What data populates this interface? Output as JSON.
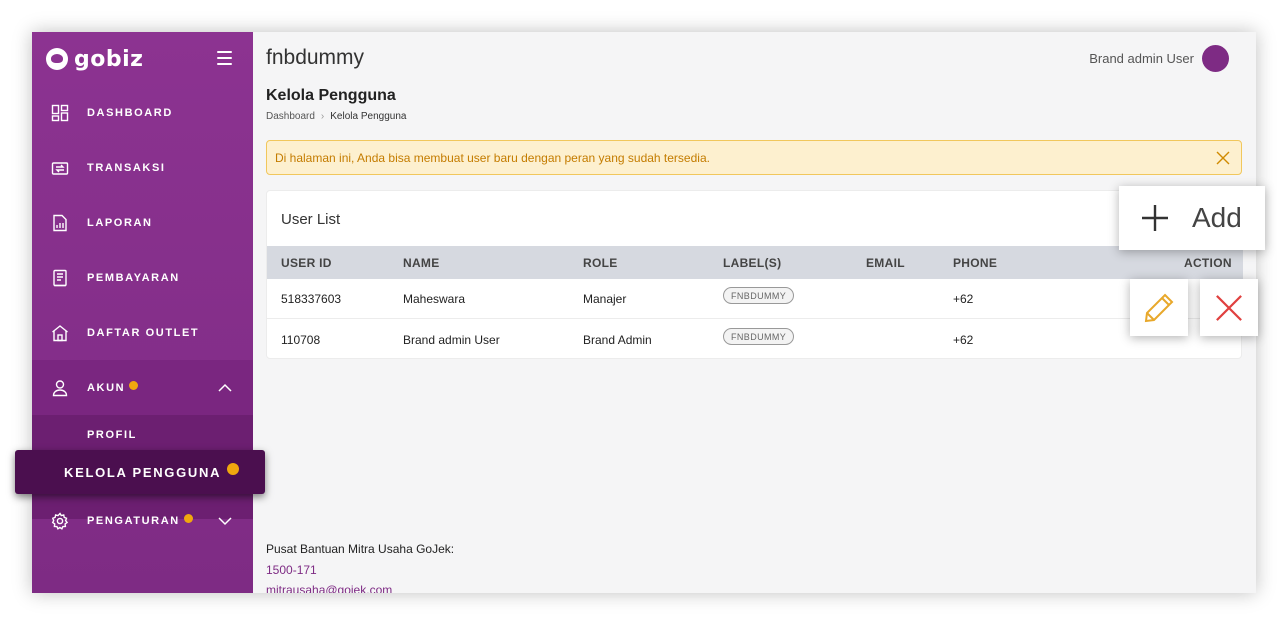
{
  "brand": {
    "name": "gobiz"
  },
  "sidebar": {
    "items": [
      {
        "label": "DASHBOARD",
        "icon": "dashboard-icon"
      },
      {
        "label": "TRANSAKSI",
        "icon": "transaction-icon"
      },
      {
        "label": "LAPORAN",
        "icon": "report-icon"
      },
      {
        "label": "PEMBAYARAN",
        "icon": "payment-icon"
      },
      {
        "label": "DAFTAR OUTLET",
        "icon": "store-icon"
      },
      {
        "label": "AKUN",
        "icon": "user-icon"
      },
      {
        "label": "PENGATURAN",
        "icon": "settings-icon"
      }
    ],
    "submenu": {
      "profil": "PROFIL",
      "kelola": "KELOLA PENGGUNA"
    }
  },
  "header": {
    "org_name": "fnbdummy",
    "user_name": "Brand admin User"
  },
  "page": {
    "title": "Kelola Pengguna",
    "breadcrumb": {
      "root": "Dashboard",
      "separator": "›",
      "current": "Kelola Pengguna"
    },
    "alert": "Di halaman ini, Anda bisa membuat user baru dengan peran yang sudah tersedia."
  },
  "user_list": {
    "title": "User List",
    "add_label": "Add",
    "columns": {
      "user_id": "USER ID",
      "name": "NAME",
      "role": "ROLE",
      "labels": "LABEL(S)",
      "email": "EMAIL",
      "phone": "PHONE",
      "action": "ACTION"
    },
    "rows": [
      {
        "user_id": "518337603",
        "name": "Maheswara",
        "role": "Manajer",
        "label": "FNBDUMMY",
        "email": "",
        "phone": "+62"
      },
      {
        "user_id": "110708",
        "name": "Brand admin User",
        "role": "Brand Admin",
        "label": "FNBDUMMY",
        "email": "",
        "phone": "+62"
      }
    ]
  },
  "footer": {
    "help_title": "Pusat Bantuan Mitra Usaha GoJek:",
    "phone": "1500-171",
    "email": "mitrausaha@gojek.com"
  },
  "colors": {
    "brand_purple": "#8c3391",
    "accent_dot": "#f0a80e",
    "alert_bg": "#fdf0cf",
    "alert_text": "#c47c00",
    "edit_icon": "#e8a82b",
    "delete_icon": "#e0403f"
  }
}
